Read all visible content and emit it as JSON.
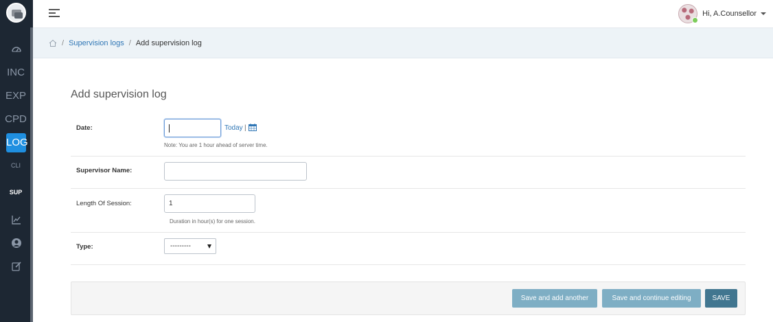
{
  "sidebar": {
    "items": [
      {
        "label": "INC"
      },
      {
        "label": "EXP"
      },
      {
        "label": "CPD"
      },
      {
        "label": "LOG"
      },
      {
        "label": "CLI"
      },
      {
        "label": "SUP"
      }
    ],
    "icons": [
      "dashboard-icon",
      "chart-icon",
      "user-circle-icon",
      "edit-icon"
    ]
  },
  "header": {
    "user_greeting": "Hi, A.Counsellor"
  },
  "breadcrumb": {
    "sep1": "/",
    "link": "Supervision logs",
    "sep2": "/",
    "current": "Add supervision log"
  },
  "form": {
    "title": "Add supervision log",
    "date": {
      "label": "Date:",
      "value": "",
      "today_link": "Today",
      "pipe": "|",
      "note": "Note: You are 1 hour ahead of server time."
    },
    "supervisor": {
      "label": "Supervisor Name:",
      "value": ""
    },
    "length": {
      "label": "Length Of Session:",
      "value": "1",
      "help": "Duration in hour(s) for one session."
    },
    "type": {
      "label": "Type:",
      "selected": "---------"
    }
  },
  "actions": {
    "save_add_another": "Save and add another",
    "save_continue": "Save and continue editing",
    "save": "SAVE"
  },
  "colors": {
    "sidebar_bg": "#1d2733",
    "active_nav": "#1f8fe0",
    "link": "#2f76b5",
    "primary_button": "#417690",
    "secondary_button": "#7eaec4"
  }
}
